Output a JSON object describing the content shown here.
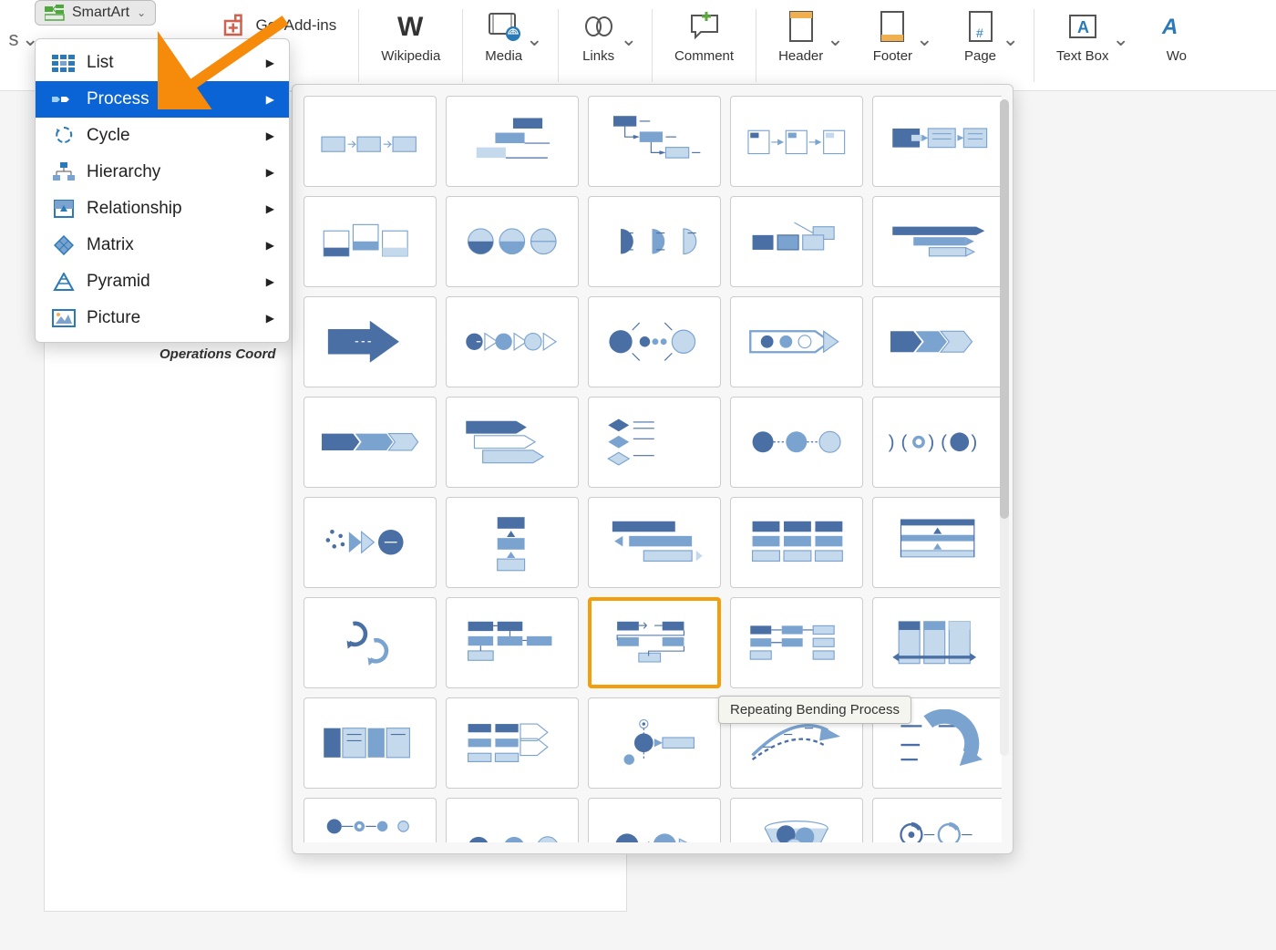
{
  "ribbon": {
    "smartart_label": "SmartArt",
    "addins_label": "Get Add-ins",
    "wikipedia_label": "Wikipedia",
    "media_label": "Media",
    "links_label": "Links",
    "comment_label": "Comment",
    "header_label": "Header",
    "footer_label": "Footer",
    "page_label": "Page",
    "textbox_label": "Text Box",
    "wordart_label": "Wo",
    "edge_left": "s"
  },
  "dropdown": {
    "items": [
      {
        "label": "List"
      },
      {
        "label": "Process"
      },
      {
        "label": "Cycle"
      },
      {
        "label": "Hierarchy"
      },
      {
        "label": "Relationship"
      },
      {
        "label": "Matrix"
      },
      {
        "label": "Pyramid"
      },
      {
        "label": "Picture"
      }
    ],
    "selected_index": 1
  },
  "thumb_panel": {
    "highlighted_index": 27,
    "tooltip": "Repeating Bending Process"
  },
  "doc": {
    "visible_text": "Operations Coord"
  },
  "colors": {
    "accent": "#0a64d6",
    "highlight": "#f59e0b",
    "smartart_green": "#4fa83d",
    "thumb_dark": "#4a6fa5",
    "thumb_mid": "#7ba3d0",
    "thumb_light": "#c5d9ed"
  }
}
